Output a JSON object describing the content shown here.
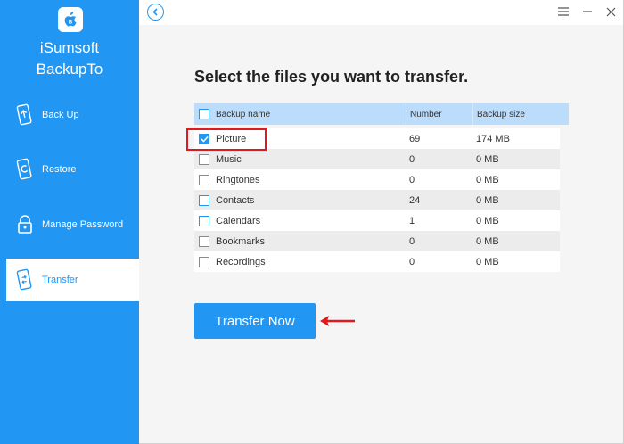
{
  "app": {
    "title_line1": "iSumsoft",
    "title_line2": "BackupTo",
    "accent_color": "#2196f3"
  },
  "sidebar": {
    "items": [
      {
        "label": "Back Up",
        "icon": "phone-backup-icon"
      },
      {
        "label": "Restore",
        "icon": "phone-restore-icon"
      },
      {
        "label": "Manage Password",
        "icon": "lock-icon"
      },
      {
        "label": "Transfer",
        "icon": "phone-transfer-icon",
        "active": true
      }
    ]
  },
  "titlebar": {
    "back_icon": "back-arrow-icon",
    "menu_icon": "menu-icon",
    "minimize_icon": "minimize-icon",
    "close_icon": "close-icon"
  },
  "main": {
    "heading": "Select the files you want to transfer.",
    "table": {
      "headers": [
        "Backup name",
        "Number",
        "Backup size"
      ],
      "rows": [
        {
          "name": "Picture",
          "number": "69",
          "size": "174 MB",
          "checked": true
        },
        {
          "name": "Music",
          "number": "0",
          "size": "0 MB",
          "checked": false
        },
        {
          "name": "Ringtones",
          "number": "0",
          "size": "0 MB",
          "checked": false
        },
        {
          "name": "Contacts",
          "number": "24",
          "size": "0 MB",
          "checked": false
        },
        {
          "name": "Calendars",
          "number": "1",
          "size": "0 MB",
          "checked": false
        },
        {
          "name": "Bookmarks",
          "number": "0",
          "size": "0 MB",
          "checked": false
        },
        {
          "name": "Recordings",
          "number": "0",
          "size": "0 MB",
          "checked": false
        }
      ]
    },
    "transfer_button": "Transfer Now",
    "highlight_color": "#e0191f"
  }
}
